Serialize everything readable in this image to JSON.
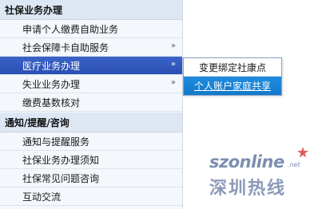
{
  "sections": [
    {
      "title": "社保业务办理",
      "items": [
        {
          "label": "申请个人缴费自助业务",
          "has_submenu": false
        },
        {
          "label": "社会保障卡自助服务",
          "has_submenu": true
        },
        {
          "label": "医疗业务办理",
          "has_submenu": true,
          "active": true
        },
        {
          "label": "失业业务办理",
          "has_submenu": true
        },
        {
          "label": "缴费基数核对",
          "has_submenu": false
        }
      ]
    },
    {
      "title": "通知/提醒/咨询",
      "items": [
        {
          "label": "通知与提醒服务"
        },
        {
          "label": "社保业务办理须知"
        },
        {
          "label": "社保常见问题咨询"
        },
        {
          "label": "互动交流"
        }
      ]
    }
  ],
  "submenu": {
    "items": [
      {
        "label": "变更绑定社康点"
      },
      {
        "label": "个人账户家庭共享"
      }
    ]
  },
  "chevron": "»",
  "watermark": {
    "brand": "szonline",
    "tld": ".net",
    "chinese": "深圳热线"
  },
  "colors": {
    "active_bg": "#2a4fb3",
    "submenu_highlight_bg": "#1479c9",
    "header_bg": "#dde7f4"
  }
}
